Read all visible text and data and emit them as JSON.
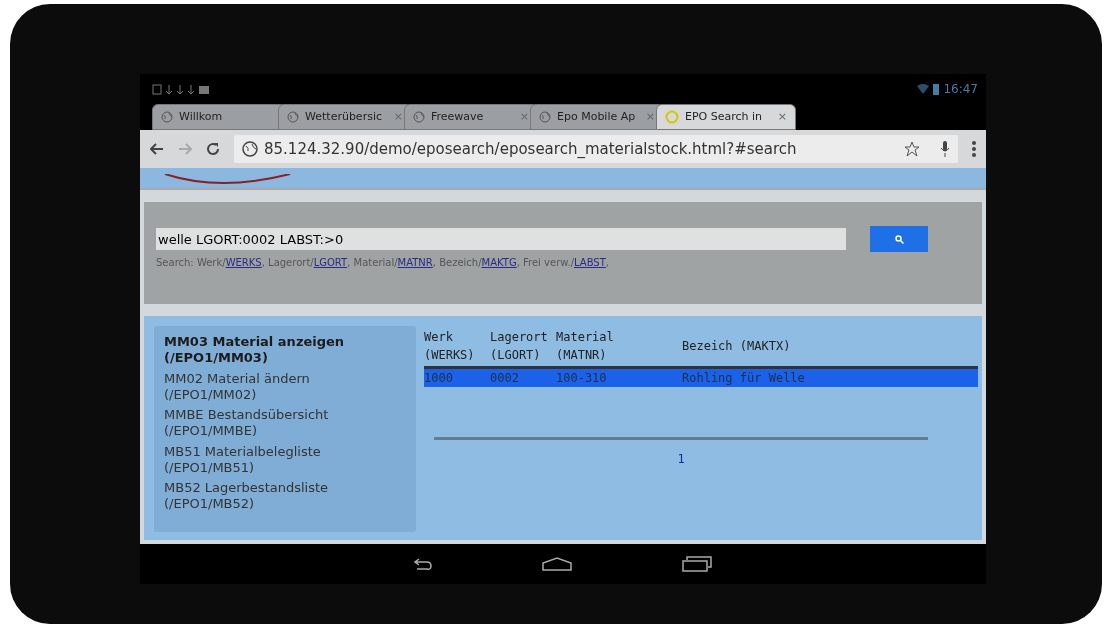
{
  "status_bar": {
    "time": "16:47"
  },
  "browser_tabs": [
    {
      "title": "Willkom",
      "selected": false
    },
    {
      "title": "Wetterübersic",
      "selected": false,
      "close": "×"
    },
    {
      "title": "Freewave",
      "selected": false,
      "close": "×"
    },
    {
      "title": "Epo Mobile Ap",
      "selected": false,
      "close": "×"
    },
    {
      "title": "EPO Search in",
      "selected": true,
      "close": "×"
    }
  ],
  "address_bar": {
    "url": "85.124.32.90/demo/eposearch/eposearch_materialstock.html?#search"
  },
  "search": {
    "value": "welle LGORT:0002 LABST:>0",
    "hint_prefix": "Search:",
    "hint_fields": [
      {
        "label": "Werk/",
        "key": "WERKS"
      },
      {
        "label": ", Lagerort/",
        "key": "LGORT"
      },
      {
        "label": ", Material/",
        "key": "MATNR"
      },
      {
        "label": ", Bezeich/",
        "key": "MAKTG"
      },
      {
        "label": ", Frei verw./",
        "key": "LABST"
      }
    ],
    "hint_suffix": ","
  },
  "menu": [
    {
      "title": "MM03 Material anzeigen",
      "code": "(/EPO1/MM03)",
      "selected": true
    },
    {
      "title": "MM02 Material ändern",
      "code": "(/EPO1/MM02)",
      "selected": false
    },
    {
      "title": "MMBE Bestandsübersicht",
      "code": "(/EPO1/MMBE)",
      "selected": false
    },
    {
      "title": "MB51 Materialbelegliste",
      "code": "(/EPO1/MB51)",
      "selected": false
    },
    {
      "title": "MB52 Lagerbestandsliste",
      "code": "(/EPO1/MB52)",
      "selected": false
    }
  ],
  "table": {
    "columns": [
      {
        "lines": [
          "Werk",
          "(WERKS)"
        ]
      },
      {
        "lines": [
          "Lagerort",
          "(LGORT)"
        ]
      },
      {
        "lines": [
          "Material",
          "(MATNR)"
        ]
      },
      {
        "lines": [
          "Bezeich (MAKTX)"
        ]
      }
    ],
    "rows": [
      {
        "cells": [
          "1000",
          "0002",
          "100-310",
          "Rohling für Welle"
        ],
        "selected": true
      }
    ]
  },
  "pager": {
    "pages": [
      {
        "label": "1",
        "selected": false
      }
    ]
  }
}
